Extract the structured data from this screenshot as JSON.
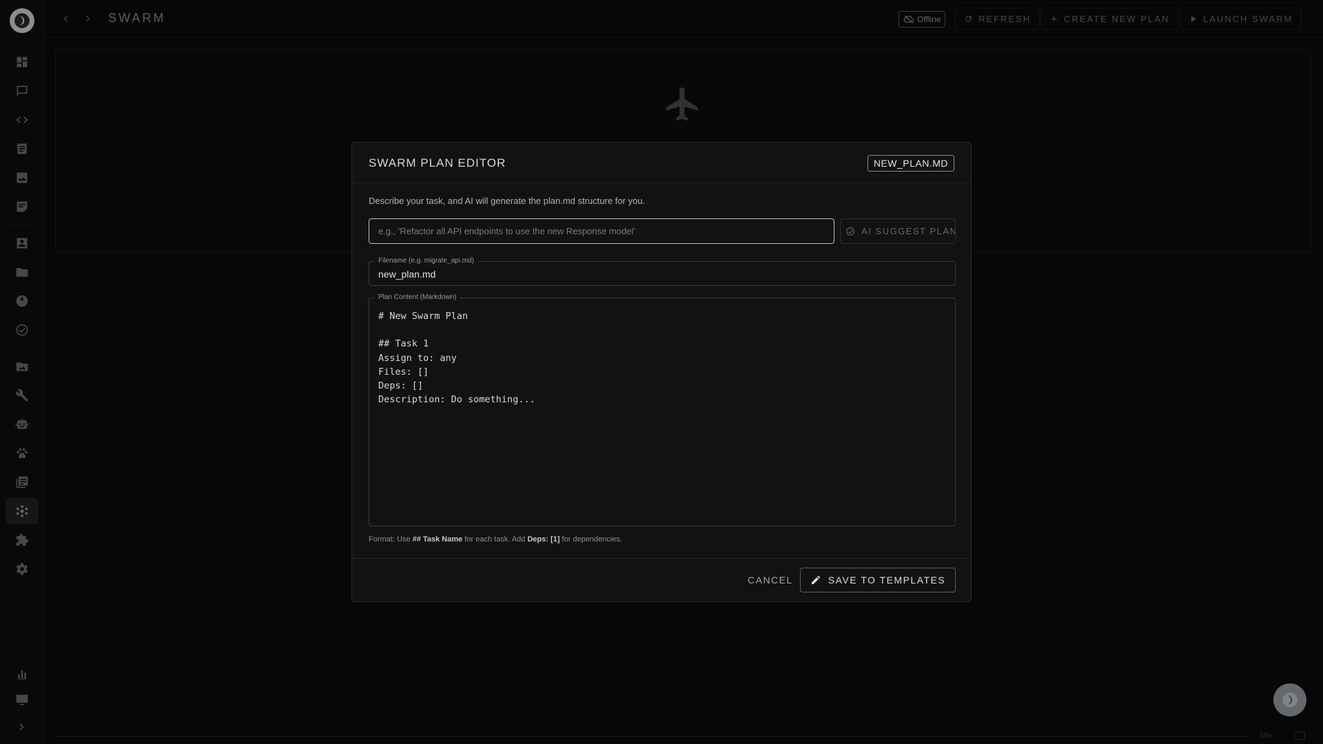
{
  "app": {
    "title": "SWARM"
  },
  "topbar": {
    "status": "Offline",
    "refresh_label": "REFRESH",
    "create_label": "CREATE NEW PLAN",
    "launch_label": "LAUNCH SWARM"
  },
  "sidebar": {
    "items": [
      {
        "icon": "dashboard-icon"
      },
      {
        "icon": "chat-icon"
      },
      {
        "icon": "code-icon"
      },
      {
        "icon": "document-icon"
      },
      {
        "icon": "image-icon"
      },
      {
        "icon": "notes-icon"
      },
      {
        "icon": "contact-icon"
      },
      {
        "icon": "folder-icon"
      },
      {
        "icon": "globe-icon"
      },
      {
        "icon": "check-circle-icon"
      },
      {
        "icon": "photo-folder-icon"
      },
      {
        "icon": "wrench-icon"
      },
      {
        "icon": "robot-icon"
      },
      {
        "icon": "paw-icon"
      },
      {
        "icon": "library-icon"
      },
      {
        "icon": "swarm-icon",
        "active": true
      },
      {
        "icon": "puzzle-icon"
      },
      {
        "icon": "settings-icon"
      },
      {
        "icon": "bar-chart-icon"
      },
      {
        "icon": "monitor-icon"
      }
    ]
  },
  "modal": {
    "title": "SWARM PLAN EDITOR",
    "filename_chip": "NEW_PLAN.MD",
    "description": "Describe your task, and AI will generate the plan.md structure for you.",
    "prompt_placeholder": "e.g., 'Refactor all API endpoints to use the new Response model'",
    "ai_button_label": "AI SUGGEST PLAN",
    "filename_legend": "Filename (e.g. migrate_api.md)",
    "filename_value": "new_plan.md",
    "content_legend": "Plan Content (Markdown)",
    "content_value": "# New Swarm Plan\n\n## Task 1\nAssign to: any\nFiles: []\nDeps: []\nDescription: Do something...",
    "hint": {
      "prefix": "Format: Use ",
      "task_token": "## Task Name",
      "middle": " for each task. Add ",
      "deps_token": "Deps: [1]",
      "suffix": " for dependencies."
    },
    "cancel_label": "CANCEL",
    "save_label": "SAVE TO TEMPLATES"
  },
  "statusbar": {
    "state": "Idle"
  }
}
